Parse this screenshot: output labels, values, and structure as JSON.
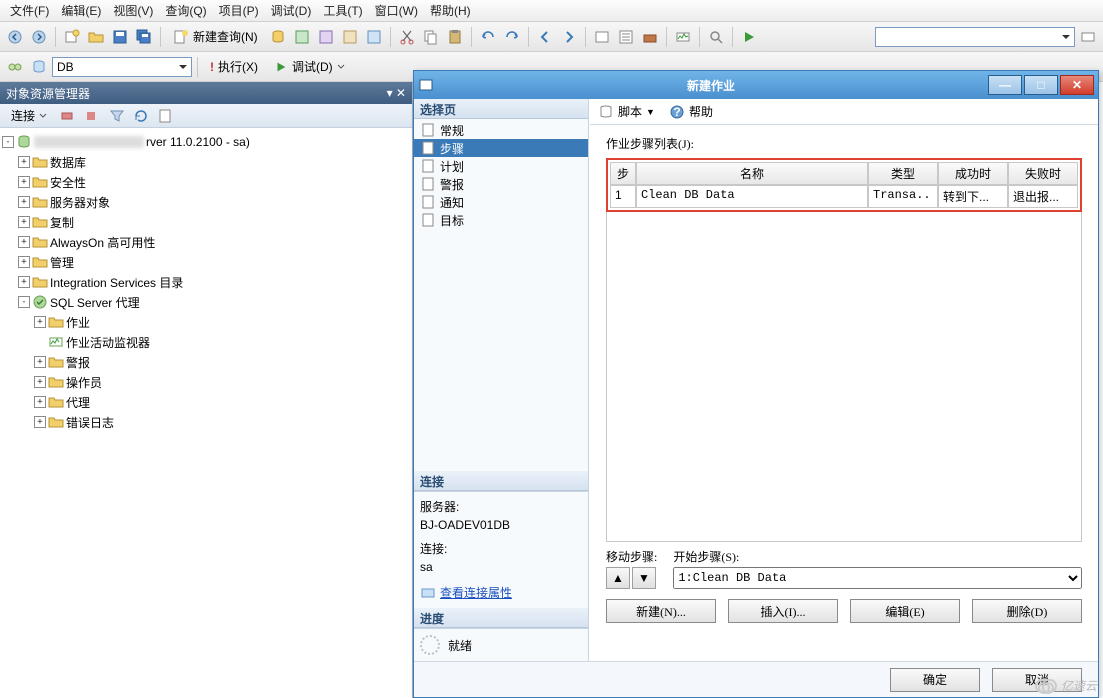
{
  "menu": {
    "items": [
      "文件(F)",
      "编辑(E)",
      "视图(V)",
      "查询(Q)",
      "项目(P)",
      "调试(D)",
      "工具(T)",
      "窗口(W)",
      "帮助(H)"
    ]
  },
  "toolbar1": {
    "new_query": "新建查询(N)"
  },
  "toolbar2": {
    "db_combo": "DB",
    "execute": "执行(X)",
    "debug": "调试(D)"
  },
  "explorer": {
    "title": "对象资源管理器",
    "connect": "连接",
    "server_suffix": "rver 11.0.2100 - sa)",
    "nodes": {
      "databases": "数据库",
      "security": "安全性",
      "server_objects": "服务器对象",
      "replication": "复制",
      "alwayson": "AlwaysOn 高可用性",
      "management": "管理",
      "isc": "Integration Services 目录",
      "agent": "SQL Server 代理",
      "jobs": "作业",
      "activity": "作业活动监视器",
      "alerts": "警报",
      "operators": "操作员",
      "proxies": "代理",
      "errorlogs": "错误日志"
    }
  },
  "dialog": {
    "title": "新建作业",
    "pages_hdr": "选择页",
    "pages": {
      "general": "常规",
      "steps": "步骤",
      "schedules": "计划",
      "alerts": "警报",
      "notifications": "通知",
      "targets": "目标"
    },
    "script": "脚本",
    "help": "帮助",
    "steps_label": "作业步骤列表(J):",
    "grid": {
      "h_step": "步",
      "h_name": "名称",
      "h_type": "类型",
      "h_success": "成功时",
      "h_fail": "失败时",
      "r1_step": "1",
      "r1_name": "Clean DB Data",
      "r1_type": "Transa..",
      "r1_ok": "转到下...",
      "r1_fail": "退出报..."
    },
    "move_label": "移动步骤:",
    "start_label": "开始步骤(S):",
    "start_value": "1:Clean DB Data",
    "btn_new": "新建(N)...",
    "btn_insert": "插入(I)...",
    "btn_edit": "编辑(E)",
    "btn_delete": "删除(D)",
    "conn_hdr": "连接",
    "server_lbl": "服务器:",
    "server_val": "BJ-OADEV01DB",
    "conn_lbl": "连接:",
    "conn_val": "sa",
    "view_props": "查看连接属性",
    "prog_hdr": "进度",
    "ready": "就绪",
    "ok": "确定",
    "cancel": "取消"
  },
  "watermark": "亿速云"
}
